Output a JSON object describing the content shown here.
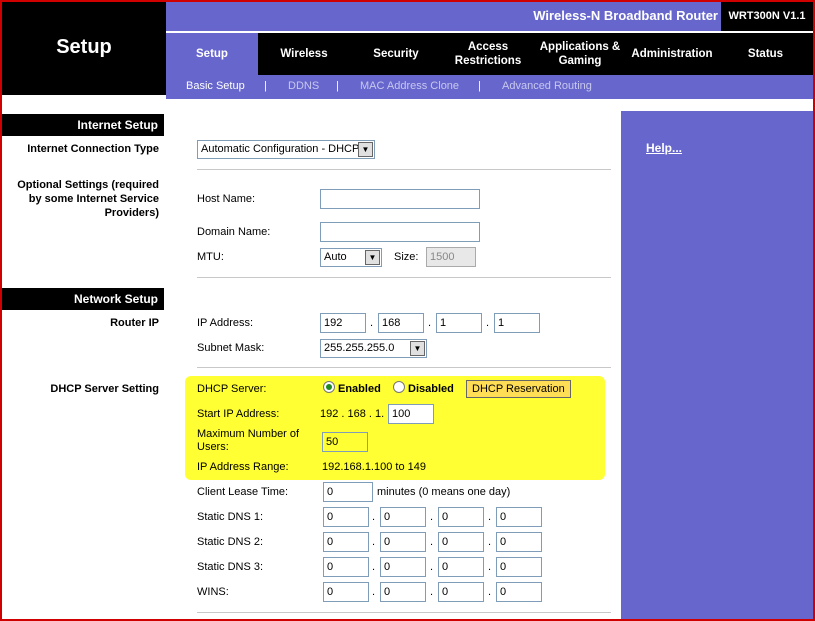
{
  "header": {
    "page_title": "Setup",
    "product_name": "Wireless-N Broadband Router",
    "model": "WRT300N V1.1"
  },
  "tabs": [
    {
      "label": "Setup"
    },
    {
      "label": "Wireless"
    },
    {
      "label": "Security"
    },
    {
      "label": "Access Restrictions"
    },
    {
      "label": "Applications & Gaming"
    },
    {
      "label": "Administration"
    },
    {
      "label": "Status"
    }
  ],
  "subtabs": [
    {
      "label": "Basic Setup"
    },
    {
      "label": "DDNS"
    },
    {
      "label": "MAC Address Clone"
    },
    {
      "label": "Advanced Routing"
    }
  ],
  "subtab_separator": "|",
  "sections": {
    "internet_setup": "Internet Setup",
    "network_setup": "Network Setup"
  },
  "left_labels": {
    "connection_type": "Internet Connection Type",
    "optional_settings": "Optional Settings (required by some Internet Service Providers)",
    "router_ip": "Router IP",
    "dhcp_server_setting": "DHCP Server Setting"
  },
  "internet": {
    "connection_type_value": "Automatic Configuration - DHCP",
    "host_name_label": "Host Name:",
    "host_name_value": "",
    "domain_name_label": "Domain Name:",
    "domain_name_value": "",
    "mtu_label": "MTU:",
    "mtu_value": "Auto",
    "size_label": "Size:",
    "size_value": "1500"
  },
  "router_ip": {
    "ip_label": "IP Address:",
    "ip": [
      "192",
      "168",
      "1",
      "1"
    ],
    "subnet_label": "Subnet Mask:",
    "subnet_value": "255.255.255.0"
  },
  "dhcp": {
    "server_label": "DHCP Server:",
    "enabled_label": "Enabled",
    "disabled_label": "Disabled",
    "enabled": true,
    "reservation_button": "DHCP Reservation",
    "start_ip_label": "Start IP Address:",
    "start_ip_prefix": "192 . 168 . 1.",
    "start_ip_last": "100",
    "max_users_label": "Maximum Number of Users:",
    "max_users_value": "50",
    "range_label": "IP Address Range:",
    "range_value": "192.168.1.100 to 149",
    "lease_label": "Client Lease Time:",
    "lease_value": "0",
    "lease_unit": "minutes (0 means one day)",
    "dns1_label": "Static DNS 1:",
    "dns1": [
      "0",
      "0",
      "0",
      "0"
    ],
    "dns2_label": "Static DNS 2:",
    "dns2": [
      "0",
      "0",
      "0",
      "0"
    ],
    "dns3_label": "Static DNS 3:",
    "dns3": [
      "0",
      "0",
      "0",
      "0"
    ],
    "wins_label": "WINS:",
    "wins": [
      "0",
      "0",
      "0",
      "0"
    ]
  },
  "help": {
    "link_label": "Help..."
  },
  "colors": {
    "accent": "#6666cc",
    "highlight": "#ffff33",
    "frame": "#d00000"
  }
}
